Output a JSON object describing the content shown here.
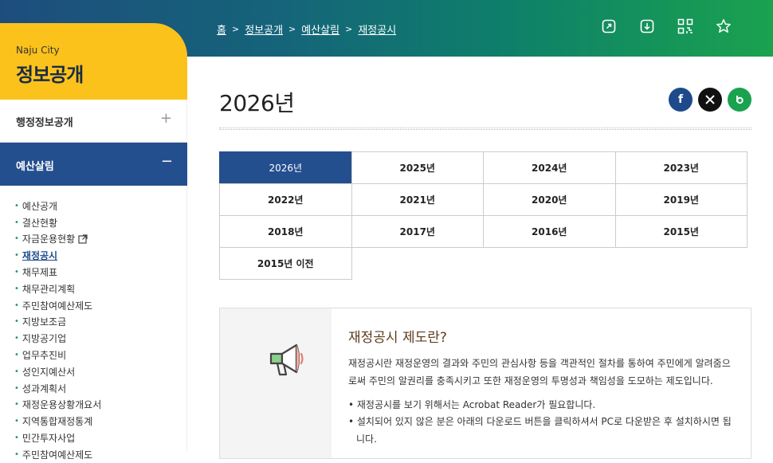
{
  "breadcrumb": [
    "홈",
    "정보공개",
    "예산살림",
    "재정공시"
  ],
  "sidebar": {
    "subtitle": "Naju City",
    "title": "정보공개",
    "menu1": {
      "label": "행정정보공개",
      "toggle": "+"
    },
    "menu2": {
      "label": "예산살림",
      "toggle": "−"
    },
    "items": [
      "예산공개",
      "결산현황",
      "자금운용현황",
      "재정공시",
      "채무제표",
      "채무관리계획",
      "주민참여예산제도",
      "지방보조금",
      "지방공기업",
      "업무추진비",
      "성인지예산서",
      "성과계획서",
      "재정운용상황개요서",
      "지역통합재정통계",
      "민간투자사업",
      "주민참여예산제도"
    ]
  },
  "page": {
    "title": "2026년"
  },
  "years": [
    [
      "2026년",
      "2025년",
      "2024년",
      "2023년"
    ],
    [
      "2022년",
      "2021년",
      "2020년",
      "2019년"
    ],
    [
      "2018년",
      "2017년",
      "2016년",
      "2015년"
    ],
    [
      "2015년 이전"
    ]
  ],
  "info": {
    "heading": "재정공시 제도란?",
    "paragraph": "재정공시란 재정운영의 결과와 주민의 관심사항 등을 객관적인 절차를 통하여 주민에게 알려줌으로써 주민의 알권리를 충족시키고 또한 재정운영의 투명성과 책임성을 도모하는 제도입니다.",
    "bullet1": "• 재정공시를 보기 위해서는 Acrobat Reader가 필요합니다.",
    "bullet2": "• 설치되어 있지 않은 분은 아래의 다운로드 버튼을 클릭하셔서 PC로 다운받은 후 설치하시면 됩니다."
  },
  "colors": {
    "accent": "#244f8f",
    "sidebar_head": "#fbc21b",
    "facebook": "#1e4a8c",
    "x": "#111111",
    "blog": "#1aa24f"
  }
}
